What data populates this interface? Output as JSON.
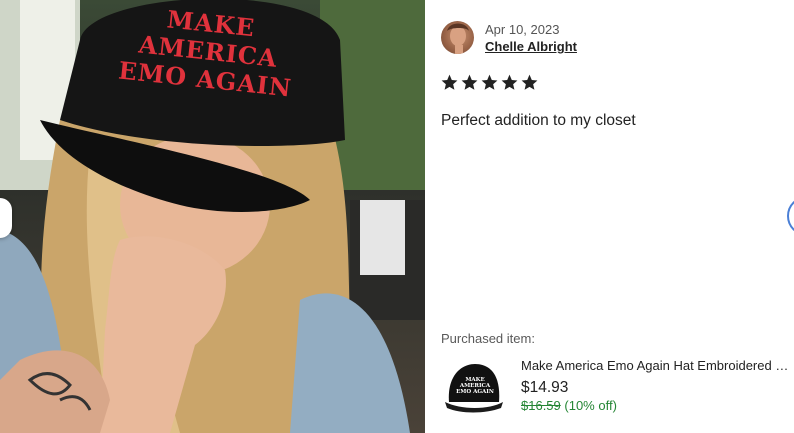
{
  "photo": {
    "hat_text_line1": "MAKE AMERICA",
    "hat_text_line2": "EMO AGAIN"
  },
  "review": {
    "date": "Apr 10, 2023",
    "reviewer_name": "Chelle Albright",
    "rating": 5,
    "max_rating": 5,
    "text": "Perfect addition to my closet"
  },
  "purchased": {
    "label": "Purchased item:",
    "title": "Make America Emo Again Hat Embroidered Baseball Cap",
    "price": "$14.93",
    "original_price": "$16.59",
    "discount": "(10% off)",
    "thumb_line1": "MAKE AMERICA",
    "thumb_line2": "EMO AGAIN"
  },
  "colors": {
    "star": "#222222",
    "discount_green": "#258635",
    "hat_text_red": "#e0323c",
    "nav_ring_blue": "#4a7fd6"
  }
}
